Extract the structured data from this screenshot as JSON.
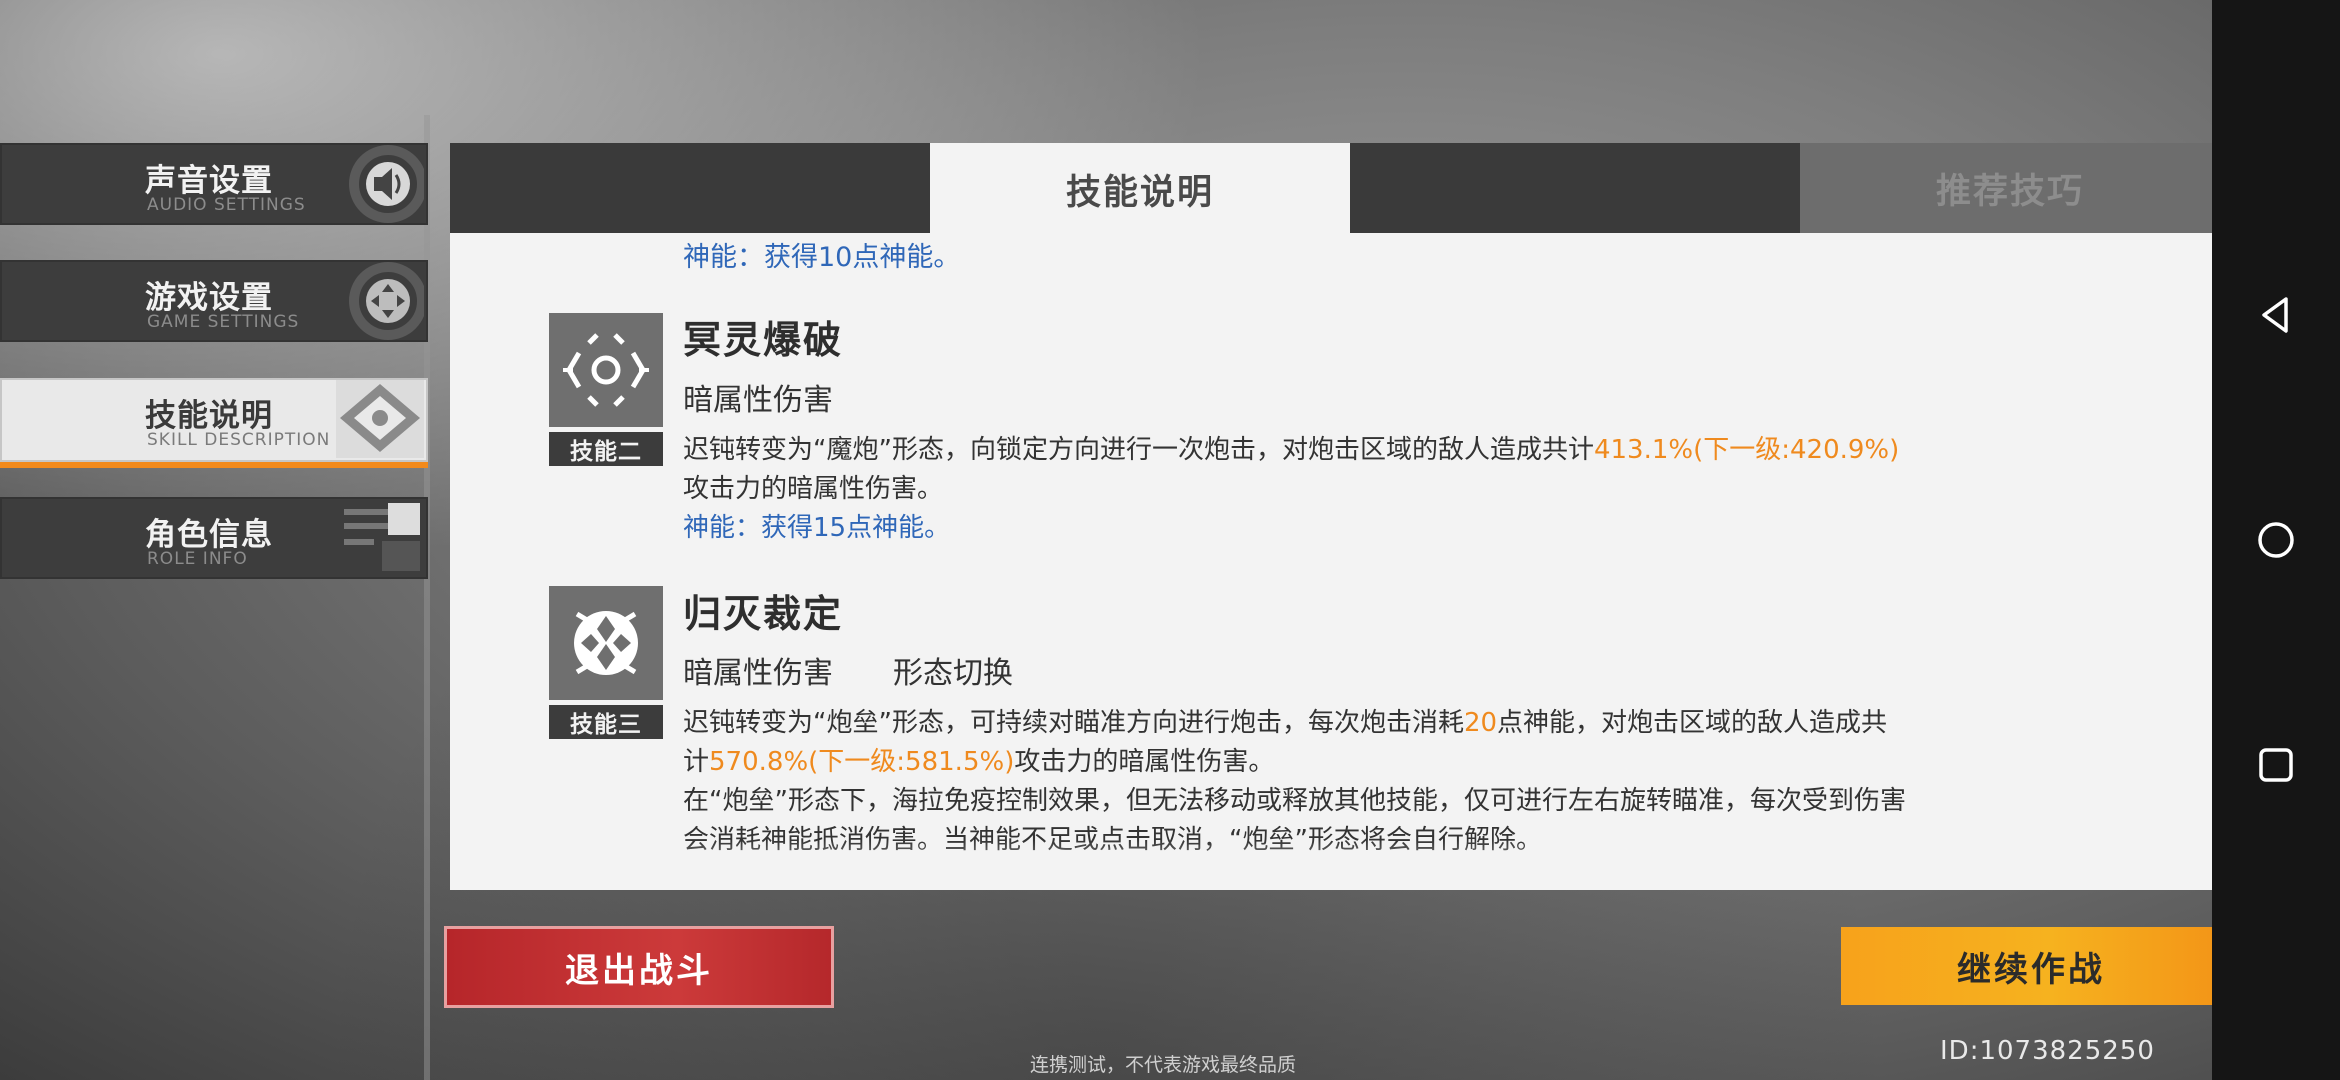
{
  "sidebar": {
    "items": [
      {
        "title": "声音设置",
        "subtitle": "AUDIO SETTINGS",
        "icon": "speaker-icon"
      },
      {
        "title": "游戏设置",
        "subtitle": "GAME SETTINGS",
        "icon": "gamepad-icon"
      },
      {
        "title": "技能说明",
        "subtitle": "SKILL DESCRIPTION",
        "icon": "diamond-icon",
        "active": true
      },
      {
        "title": "角色信息",
        "subtitle": "ROLE INFO",
        "icon": "card-icon"
      }
    ]
  },
  "tabs": [
    {
      "label": "技能说明",
      "active": true
    },
    {
      "label": "推荐技巧",
      "active": false
    }
  ],
  "skills": {
    "prev_energy": "神能：获得10点神能。",
    "skill2": {
      "name": "冥灵爆破",
      "tag": "技能二",
      "types": [
        "暗属性伤害"
      ],
      "desc_pre": "迟钝转变为“魔炮”形态，向锁定方向进行一次炮击，对炮击区域的敌人造成共计",
      "desc_hl": "413.1%(下一级:420.9%)",
      "desc_post": "攻击力的暗属性伤害。",
      "energy": "神能：获得15点神能。"
    },
    "skill3": {
      "name": "归灭裁定",
      "tag": "技能三",
      "types": [
        "暗属性伤害",
        "形态切换"
      ],
      "desc_a": "迟钝转变为“炮垒”形态，可持续对瞄准方向进行炮击，每次炮击消耗",
      "desc_hl1": "20",
      "desc_b": "点神能，对炮击区域的敌人造成共计",
      "desc_hl2": "570.8%(下一级:581.5%)",
      "desc_c": "攻击力的暗属性伤害。",
      "desc2": "在“炮垒”形态下，海拉免疫控制效果，但无法移动或释放其他技能，仅可进行左右旋转瞄准，每次受到伤害会消耗神能抵消伤害。当神能不足或点击取消，“炮垒”形态将会自行解除。"
    }
  },
  "buttons": {
    "exit": "退出战斗",
    "continue": "继续作战"
  },
  "uid": "ID:1073825250",
  "footnote": "连携测试，不代表游戏最终品质",
  "colors": {
    "highlight": "#ef8a1e",
    "energy": "#2f67b8",
    "exit_button": "#c0302f",
    "continue_button": "#f6a81c",
    "active_accent": "#f28a1c"
  }
}
